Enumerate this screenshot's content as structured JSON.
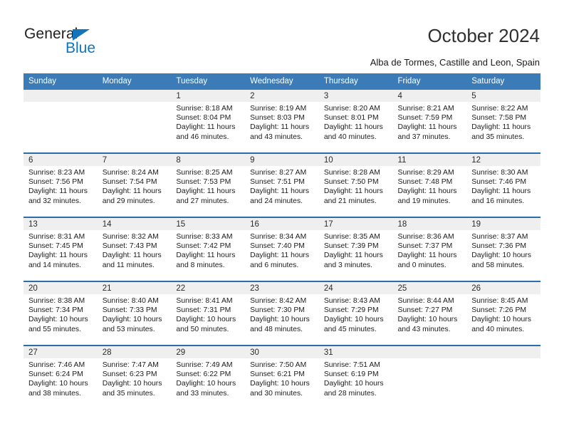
{
  "brand": {
    "name_part1": "General",
    "name_part2": "Blue",
    "accent_color": "#1275bc",
    "triangle_icon": "brand-triangle-icon"
  },
  "header": {
    "title": "October 2024",
    "subtitle": "Alba de Tormes, Castille and Leon, Spain"
  },
  "theme": {
    "header_blue": "#3b7cb8",
    "row_divider_blue": "#2b6cab",
    "daynum_band_gray": "#efefef"
  },
  "weekdays": [
    "Sunday",
    "Monday",
    "Tuesday",
    "Wednesday",
    "Thursday",
    "Friday",
    "Saturday"
  ],
  "labels": {
    "sunrise_prefix": "Sunrise:",
    "sunset_prefix": "Sunset:",
    "daylight_prefix": "Daylight:"
  },
  "weeks": [
    [
      {
        "day": "",
        "sunrise": "",
        "sunset": "",
        "daylight": ""
      },
      {
        "day": "",
        "sunrise": "",
        "sunset": "",
        "daylight": ""
      },
      {
        "day": "1",
        "sunrise": "Sunrise: 8:18 AM",
        "sunset": "Sunset: 8:04 PM",
        "daylight": "Daylight: 11 hours and 46 minutes."
      },
      {
        "day": "2",
        "sunrise": "Sunrise: 8:19 AM",
        "sunset": "Sunset: 8:03 PM",
        "daylight": "Daylight: 11 hours and 43 minutes."
      },
      {
        "day": "3",
        "sunrise": "Sunrise: 8:20 AM",
        "sunset": "Sunset: 8:01 PM",
        "daylight": "Daylight: 11 hours and 40 minutes."
      },
      {
        "day": "4",
        "sunrise": "Sunrise: 8:21 AM",
        "sunset": "Sunset: 7:59 PM",
        "daylight": "Daylight: 11 hours and 37 minutes."
      },
      {
        "day": "5",
        "sunrise": "Sunrise: 8:22 AM",
        "sunset": "Sunset: 7:58 PM",
        "daylight": "Daylight: 11 hours and 35 minutes."
      }
    ],
    [
      {
        "day": "6",
        "sunrise": "Sunrise: 8:23 AM",
        "sunset": "Sunset: 7:56 PM",
        "daylight": "Daylight: 11 hours and 32 minutes."
      },
      {
        "day": "7",
        "sunrise": "Sunrise: 8:24 AM",
        "sunset": "Sunset: 7:54 PM",
        "daylight": "Daylight: 11 hours and 29 minutes."
      },
      {
        "day": "8",
        "sunrise": "Sunrise: 8:25 AM",
        "sunset": "Sunset: 7:53 PM",
        "daylight": "Daylight: 11 hours and 27 minutes."
      },
      {
        "day": "9",
        "sunrise": "Sunrise: 8:27 AM",
        "sunset": "Sunset: 7:51 PM",
        "daylight": "Daylight: 11 hours and 24 minutes."
      },
      {
        "day": "10",
        "sunrise": "Sunrise: 8:28 AM",
        "sunset": "Sunset: 7:50 PM",
        "daylight": "Daylight: 11 hours and 21 minutes."
      },
      {
        "day": "11",
        "sunrise": "Sunrise: 8:29 AM",
        "sunset": "Sunset: 7:48 PM",
        "daylight": "Daylight: 11 hours and 19 minutes."
      },
      {
        "day": "12",
        "sunrise": "Sunrise: 8:30 AM",
        "sunset": "Sunset: 7:46 PM",
        "daylight": "Daylight: 11 hours and 16 minutes."
      }
    ],
    [
      {
        "day": "13",
        "sunrise": "Sunrise: 8:31 AM",
        "sunset": "Sunset: 7:45 PM",
        "daylight": "Daylight: 11 hours and 14 minutes."
      },
      {
        "day": "14",
        "sunrise": "Sunrise: 8:32 AM",
        "sunset": "Sunset: 7:43 PM",
        "daylight": "Daylight: 11 hours and 11 minutes."
      },
      {
        "day": "15",
        "sunrise": "Sunrise: 8:33 AM",
        "sunset": "Sunset: 7:42 PM",
        "daylight": "Daylight: 11 hours and 8 minutes."
      },
      {
        "day": "16",
        "sunrise": "Sunrise: 8:34 AM",
        "sunset": "Sunset: 7:40 PM",
        "daylight": "Daylight: 11 hours and 6 minutes."
      },
      {
        "day": "17",
        "sunrise": "Sunrise: 8:35 AM",
        "sunset": "Sunset: 7:39 PM",
        "daylight": "Daylight: 11 hours and 3 minutes."
      },
      {
        "day": "18",
        "sunrise": "Sunrise: 8:36 AM",
        "sunset": "Sunset: 7:37 PM",
        "daylight": "Daylight: 11 hours and 0 minutes."
      },
      {
        "day": "19",
        "sunrise": "Sunrise: 8:37 AM",
        "sunset": "Sunset: 7:36 PM",
        "daylight": "Daylight: 10 hours and 58 minutes."
      }
    ],
    [
      {
        "day": "20",
        "sunrise": "Sunrise: 8:38 AM",
        "sunset": "Sunset: 7:34 PM",
        "daylight": "Daylight: 10 hours and 55 minutes."
      },
      {
        "day": "21",
        "sunrise": "Sunrise: 8:40 AM",
        "sunset": "Sunset: 7:33 PM",
        "daylight": "Daylight: 10 hours and 53 minutes."
      },
      {
        "day": "22",
        "sunrise": "Sunrise: 8:41 AM",
        "sunset": "Sunset: 7:31 PM",
        "daylight": "Daylight: 10 hours and 50 minutes."
      },
      {
        "day": "23",
        "sunrise": "Sunrise: 8:42 AM",
        "sunset": "Sunset: 7:30 PM",
        "daylight": "Daylight: 10 hours and 48 minutes."
      },
      {
        "day": "24",
        "sunrise": "Sunrise: 8:43 AM",
        "sunset": "Sunset: 7:29 PM",
        "daylight": "Daylight: 10 hours and 45 minutes."
      },
      {
        "day": "25",
        "sunrise": "Sunrise: 8:44 AM",
        "sunset": "Sunset: 7:27 PM",
        "daylight": "Daylight: 10 hours and 43 minutes."
      },
      {
        "day": "26",
        "sunrise": "Sunrise: 8:45 AM",
        "sunset": "Sunset: 7:26 PM",
        "daylight": "Daylight: 10 hours and 40 minutes."
      }
    ],
    [
      {
        "day": "27",
        "sunrise": "Sunrise: 7:46 AM",
        "sunset": "Sunset: 6:24 PM",
        "daylight": "Daylight: 10 hours and 38 minutes."
      },
      {
        "day": "28",
        "sunrise": "Sunrise: 7:47 AM",
        "sunset": "Sunset: 6:23 PM",
        "daylight": "Daylight: 10 hours and 35 minutes."
      },
      {
        "day": "29",
        "sunrise": "Sunrise: 7:49 AM",
        "sunset": "Sunset: 6:22 PM",
        "daylight": "Daylight: 10 hours and 33 minutes."
      },
      {
        "day": "30",
        "sunrise": "Sunrise: 7:50 AM",
        "sunset": "Sunset: 6:21 PM",
        "daylight": "Daylight: 10 hours and 30 minutes."
      },
      {
        "day": "31",
        "sunrise": "Sunrise: 7:51 AM",
        "sunset": "Sunset: 6:19 PM",
        "daylight": "Daylight: 10 hours and 28 minutes."
      },
      {
        "day": "",
        "sunrise": "",
        "sunset": "",
        "daylight": ""
      },
      {
        "day": "",
        "sunrise": "",
        "sunset": "",
        "daylight": ""
      }
    ]
  ]
}
